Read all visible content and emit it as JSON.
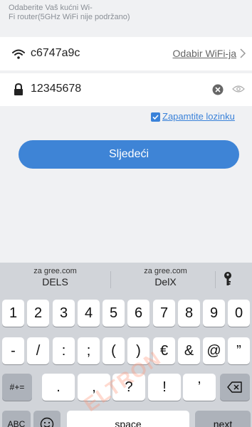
{
  "hint": {
    "line1": "Odaberite Vaš kućni Wi-",
    "line2": "Fi router(5GHz WiFi nije podržano)"
  },
  "wifi": {
    "ssid": "c6747a9c",
    "select_label": "Odabir WiFi-ja"
  },
  "password": {
    "value": "12345678"
  },
  "remember": {
    "label": "Zapamtite lozinku",
    "checked": true
  },
  "next_button": "Sljedeći",
  "keyboard": {
    "suggestions": [
      {
        "source": "za gree.com",
        "word": "DELS"
      },
      {
        "source": "za gree.com",
        "word": "DelX"
      }
    ],
    "row1": [
      "1",
      "2",
      "3",
      "4",
      "5",
      "6",
      "7",
      "8",
      "9",
      "0"
    ],
    "row2": [
      "-",
      "/",
      ":",
      ";",
      "(",
      ")",
      "€",
      "&",
      "@",
      "”"
    ],
    "row3": [
      ".",
      ",",
      "?",
      "!",
      "’"
    ],
    "mode_key": "#+=",
    "abc_key": "ABC",
    "space_key": "space",
    "next_key": "next"
  },
  "watermark": "ELTRON",
  "colors": {
    "accent": "#3e84d6",
    "background": "#f0f1f3",
    "keyboard": "#d1d4d9"
  }
}
